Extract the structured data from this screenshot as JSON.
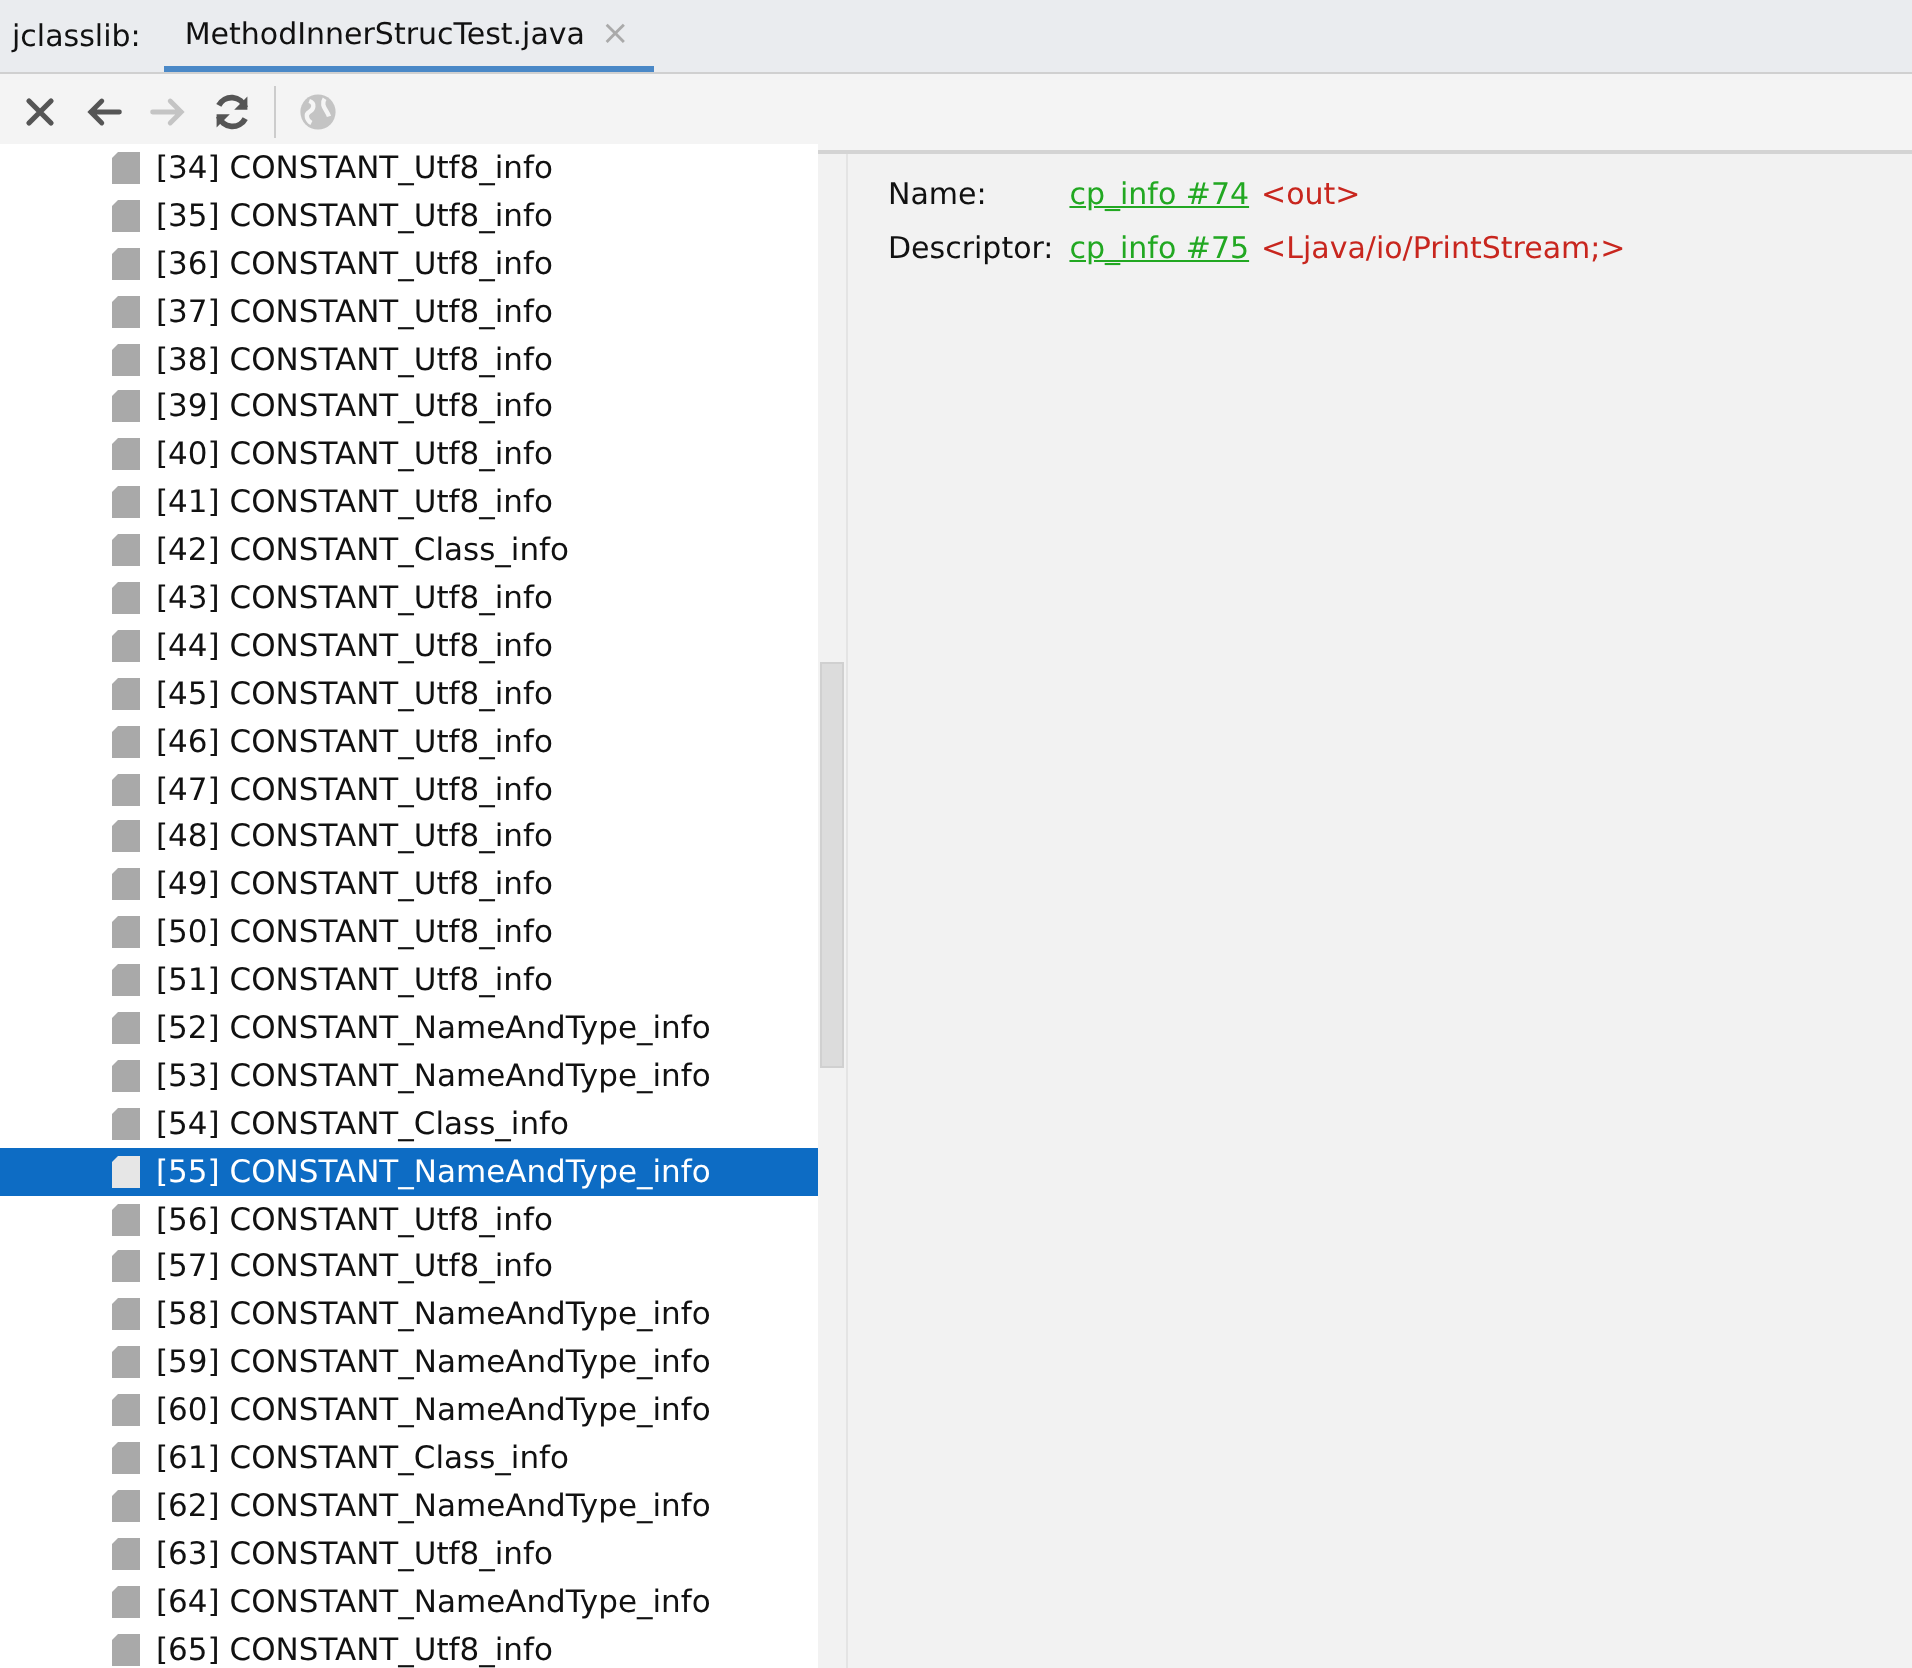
{
  "tabs": {
    "label": "jclasslib:",
    "items": [
      {
        "title": "MethodInnerStrucTest.java",
        "selected": true,
        "close": "×"
      }
    ]
  },
  "toolbar": {
    "buttons": [
      {
        "kind": "close",
        "disabled": false
      },
      {
        "kind": "back",
        "disabled": false
      },
      {
        "kind": "forward",
        "disabled": true
      },
      {
        "kind": "refresh",
        "disabled": false
      },
      {
        "kind": "web",
        "disabled": true
      }
    ]
  },
  "tree": {
    "items": [
      {
        "label": "[34] CONSTANT_Utf8_info",
        "selected": false
      },
      {
        "label": "[35] CONSTANT_Utf8_info",
        "selected": false
      },
      {
        "label": "[36] CONSTANT_Utf8_info",
        "selected": false
      },
      {
        "label": "[37] CONSTANT_Utf8_info",
        "selected": false
      },
      {
        "label": "[38] CONSTANT_Utf8_info",
        "selected": false
      },
      {
        "label": "[39] CONSTANT_Utf8_info",
        "selected": false
      },
      {
        "label": "[40] CONSTANT_Utf8_info",
        "selected": false
      },
      {
        "label": "[41] CONSTANT_Utf8_info",
        "selected": false
      },
      {
        "label": "[42] CONSTANT_Class_info",
        "selected": false
      },
      {
        "label": "[43] CONSTANT_Utf8_info",
        "selected": false
      },
      {
        "label": "[44] CONSTANT_Utf8_info",
        "selected": false
      },
      {
        "label": "[45] CONSTANT_Utf8_info",
        "selected": false
      },
      {
        "label": "[46] CONSTANT_Utf8_info",
        "selected": false
      },
      {
        "label": "[47] CONSTANT_Utf8_info",
        "selected": false
      },
      {
        "label": "[48] CONSTANT_Utf8_info",
        "selected": false
      },
      {
        "label": "[49] CONSTANT_Utf8_info",
        "selected": false
      },
      {
        "label": "[50] CONSTANT_Utf8_info",
        "selected": false
      },
      {
        "label": "[51] CONSTANT_Utf8_info",
        "selected": false
      },
      {
        "label": "[52] CONSTANT_NameAndType_info",
        "selected": false
      },
      {
        "label": "[53] CONSTANT_NameAndType_info",
        "selected": false
      },
      {
        "label": "[54] CONSTANT_Class_info",
        "selected": false
      },
      {
        "label": "[55] CONSTANT_NameAndType_info",
        "selected": true
      },
      {
        "label": "[56] CONSTANT_Utf8_info",
        "selected": false
      },
      {
        "label": "[57] CONSTANT_Utf8_info",
        "selected": false
      },
      {
        "label": "[58] CONSTANT_NameAndType_info",
        "selected": false
      },
      {
        "label": "[59] CONSTANT_NameAndType_info",
        "selected": false
      },
      {
        "label": "[60] CONSTANT_NameAndType_info",
        "selected": false
      },
      {
        "label": "[61] CONSTANT_Class_info",
        "selected": false
      },
      {
        "label": "[62] CONSTANT_NameAndType_info",
        "selected": false
      },
      {
        "label": "[63] CONSTANT_Utf8_info",
        "selected": false
      },
      {
        "label": "[64] CONSTANT_NameAndType_info",
        "selected": false
      },
      {
        "label": "[65] CONSTANT_Utf8_info",
        "selected": false
      }
    ]
  },
  "details": [
    {
      "label": "Name:",
      "link": "cp_info #74",
      "value": "<out>"
    },
    {
      "label": "Descriptor:",
      "link": "cp_info #75",
      "value": "<Ljava/io/PrintStream;>"
    }
  ]
}
